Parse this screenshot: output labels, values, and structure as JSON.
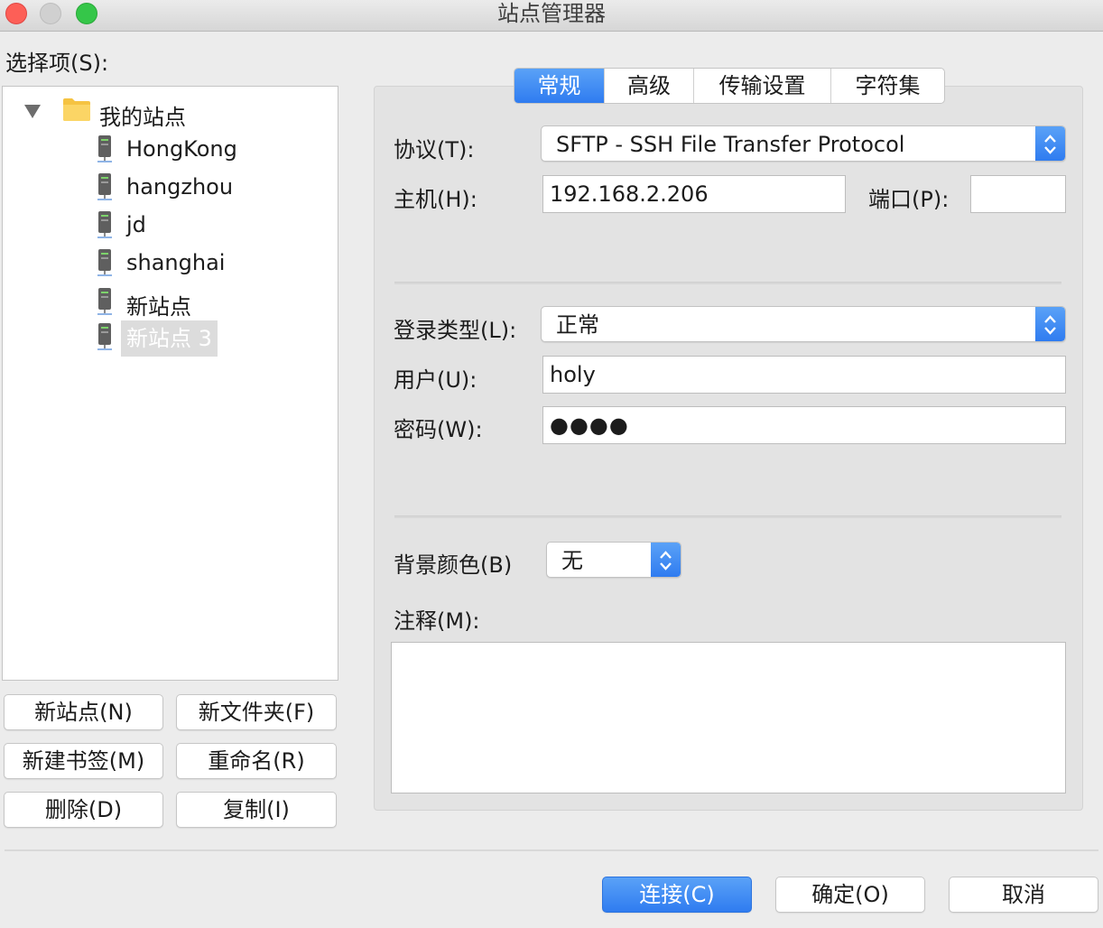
{
  "window": {
    "title": "站点管理器"
  },
  "select_label": "选择项(S):",
  "tree": {
    "root": {
      "label": "我的站点",
      "expanded": true
    },
    "sites": [
      {
        "label": "HongKong"
      },
      {
        "label": "hangzhou"
      },
      {
        "label": "jd"
      },
      {
        "label": "shanghai"
      },
      {
        "label": "新站点"
      },
      {
        "label": "新站点 3",
        "selected": true
      }
    ]
  },
  "left_buttons": {
    "new_site": "新站点(N)",
    "new_folder": "新文件夹(F)",
    "new_bookmark": "新建书签(M)",
    "rename": "重命名(R)",
    "delete": "删除(D)",
    "duplicate": "复制(I)"
  },
  "tabs": [
    {
      "label": "常规",
      "active": true
    },
    {
      "label": "高级",
      "active": false
    },
    {
      "label": "传输设置",
      "active": false
    },
    {
      "label": "字符集",
      "active": false
    }
  ],
  "general": {
    "protocol_label": "协议(T):",
    "protocol_value": "SFTP - SSH File Transfer Protocol",
    "host_label": "主机(H):",
    "host_value": "192.168.2.206",
    "port_label": "端口(P):",
    "port_value": "",
    "logon_type_label": "登录类型(L):",
    "logon_type_value": "正常",
    "user_label": "用户(U):",
    "user_value": "holy",
    "password_label": "密码(W):",
    "password_value": "●●●●",
    "background_label": "背景颜色(B)",
    "background_value": "无",
    "comments_label": "注释(M):",
    "comments_value": ""
  },
  "footer": {
    "connect": "连接(C)",
    "ok": "确定(O)",
    "cancel": "取消"
  },
  "colors": {
    "accent": "#3b86f2",
    "window_bg": "#ececec",
    "panel_bg": "#e3e3e3",
    "close": "#fd5f57",
    "minimize": "#d0d0d0",
    "maximize": "#35c649"
  }
}
